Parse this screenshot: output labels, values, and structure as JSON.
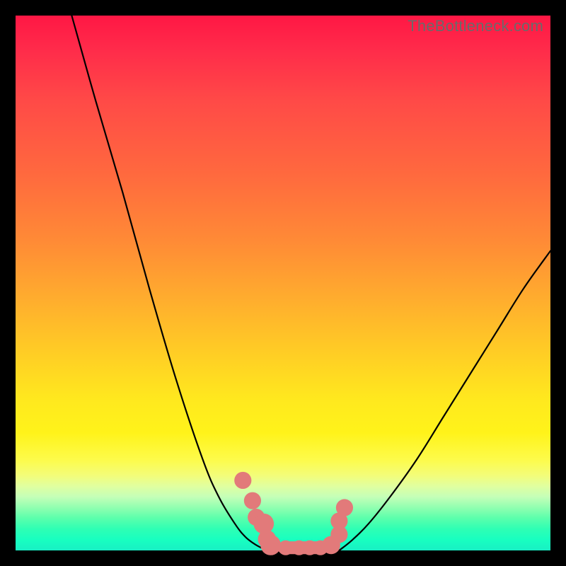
{
  "watermark": "TheBottleneck.com",
  "colors": {
    "frame": "#000000",
    "curve": "#000000",
    "marker": "#e27a7a",
    "gradient_top": "#ff1744",
    "gradient_mid": "#ffe91e",
    "gradient_bottom": "#18ffc0"
  },
  "chart_data": {
    "type": "line",
    "title": "",
    "xlabel": "",
    "ylabel": "",
    "xlim": [
      0,
      100
    ],
    "ylim": [
      0,
      100
    ],
    "grid": false,
    "legend": false,
    "series": [
      {
        "name": "left-curve",
        "x": [
          10.5,
          15,
          20,
          25,
          30,
          35,
          38,
          41,
          43,
          45,
          47
        ],
        "y": [
          100,
          84,
          67,
          49,
          32,
          17,
          10,
          5,
          2.5,
          1,
          0
        ]
      },
      {
        "name": "valley-floor",
        "x": [
          47,
          49,
          51,
          53,
          55,
          57,
          59,
          60.5
        ],
        "y": [
          0,
          0,
          0,
          0,
          0,
          0,
          0,
          0
        ]
      },
      {
        "name": "right-curve",
        "x": [
          60.5,
          63,
          66,
          70,
          75,
          80,
          85,
          90,
          95,
          100
        ],
        "y": [
          0,
          2,
          5,
          10,
          17,
          25,
          33,
          41,
          49,
          56
        ]
      }
    ],
    "markers": [
      {
        "x": 42.5,
        "y": 13.1,
        "r": 1.6
      },
      {
        "x": 44.3,
        "y": 9.3,
        "r": 1.6
      },
      {
        "x": 45.0,
        "y": 6.2,
        "r": 1.6
      },
      {
        "x": 46.4,
        "y": 5.0,
        "r": 1.9
      },
      {
        "x": 47.0,
        "y": 2.1,
        "r": 1.7
      },
      {
        "x": 47.7,
        "y": 1.0,
        "r": 1.9
      },
      {
        "x": 50.5,
        "y": 0.5,
        "r": 1.4
      },
      {
        "x": 53.0,
        "y": 0.5,
        "r": 1.4
      },
      {
        "x": 55.0,
        "y": 0.5,
        "r": 1.4
      },
      {
        "x": 57.0,
        "y": 0.5,
        "r": 1.4
      },
      {
        "x": 59.0,
        "y": 1.0,
        "r": 1.7
      },
      {
        "x": 60.5,
        "y": 3.0,
        "r": 1.6
      },
      {
        "x": 60.5,
        "y": 5.5,
        "r": 1.6
      },
      {
        "x": 61.5,
        "y": 8.0,
        "r": 1.6
      }
    ],
    "marker_bar": {
      "x0": 49.0,
      "x1": 58.5,
      "y": 0.5,
      "height": 2.4
    }
  }
}
